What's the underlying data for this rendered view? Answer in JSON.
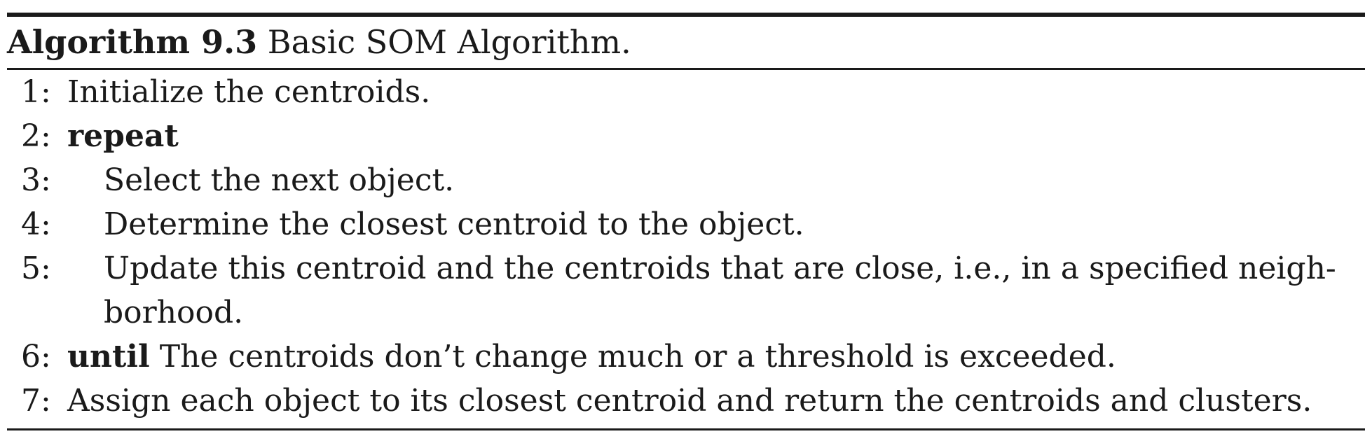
{
  "caption": {
    "label": "Algorithm 9.3",
    "title": "Basic SOM Algorithm."
  },
  "lines": [
    {
      "number": "1:",
      "keyword": "",
      "text": "Initialize the centroids."
    },
    {
      "number": "2:",
      "keyword": "repeat",
      "text": ""
    },
    {
      "number": "3:",
      "keyword": "",
      "text": "Select the next object."
    },
    {
      "number": "4:",
      "keyword": "",
      "text": "Determine the closest centroid to the object."
    },
    {
      "number": "5:",
      "keyword": "",
      "text": "Update this centroid and the centroids that are close, i.e., in a specified neigh-",
      "continuation": "borhood."
    },
    {
      "number": "6:",
      "keyword": "until",
      "text": "The centroids don’t change much or a threshold is exceeded."
    },
    {
      "number": "7:",
      "keyword": "",
      "text": "Assign each object to its closest centroid and return the centroids and clusters."
    }
  ]
}
